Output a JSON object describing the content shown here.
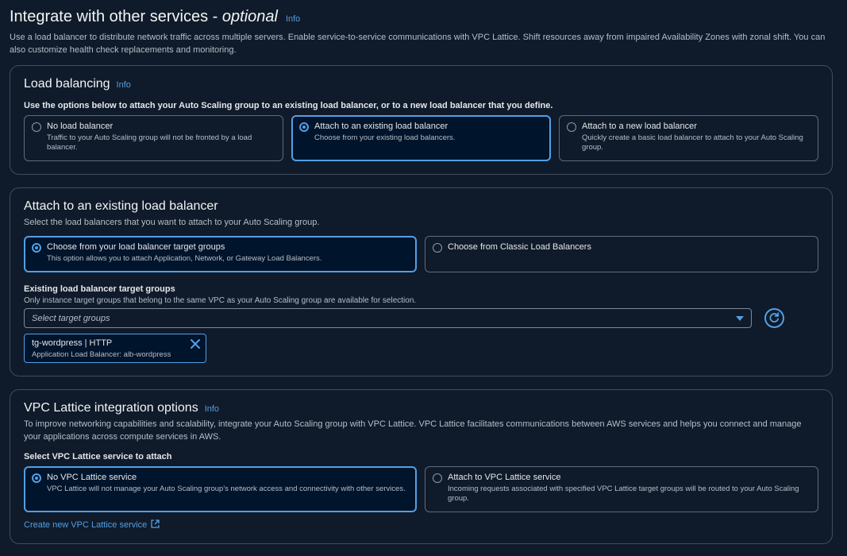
{
  "header": {
    "title": "Integrate with other services - ",
    "title_optional": "optional",
    "info": "Info",
    "description": "Use a load balancer to distribute network traffic across multiple servers. Enable service-to-service communications with VPC Lattice. Shift resources away from impaired Availability Zones with zonal shift. You can also customize health check replacements and monitoring."
  },
  "load_balancing": {
    "title": "Load balancing",
    "info": "Info",
    "instruction": "Use the options below to attach your Auto Scaling group to an existing load balancer, or to a new load balancer that you define.",
    "options": [
      {
        "title": "No load balancer",
        "desc": "Traffic to your Auto Scaling group will not be fronted by a load balancer.",
        "selected": false
      },
      {
        "title": "Attach to an existing load balancer",
        "desc": "Choose from your existing load balancers.",
        "selected": true
      },
      {
        "title": "Attach to a new load balancer",
        "desc": "Quickly create a basic load balancer to attach to your Auto Scaling group.",
        "selected": false
      }
    ]
  },
  "existing_lb": {
    "title": "Attach to an existing load balancer",
    "description": "Select the load balancers that you want to attach to your Auto Scaling group.",
    "options": [
      {
        "title": "Choose from your load balancer target groups",
        "desc": "This option allows you to attach Application, Network, or Gateway Load Balancers.",
        "selected": true
      },
      {
        "title": "Choose from Classic Load Balancers",
        "desc": "",
        "selected": false
      }
    ],
    "target_groups_label": "Existing load balancer target groups",
    "target_groups_desc": "Only instance target groups that belong to the same VPC as your Auto Scaling group are available for selection.",
    "select_placeholder": "Select target groups",
    "token": {
      "title": "tg-wordpress | HTTP",
      "desc": "Application Load Balancer: alb-wordpress"
    }
  },
  "vpc_lattice": {
    "title": "VPC Lattice integration options",
    "info": "Info",
    "description": "To improve networking capabilities and scalability, integrate your Auto Scaling group with VPC Lattice. VPC Lattice facilitates communications between AWS services and helps you connect and manage your applications across compute services in AWS.",
    "select_label": "Select VPC Lattice service to attach",
    "options": [
      {
        "title": "No VPC Lattice service",
        "desc": "VPC Lattice will not manage your Auto Scaling group's network access and connectivity with other services.",
        "selected": true
      },
      {
        "title": "Attach to VPC Lattice service",
        "desc": "Incoming requests associated with specified VPC Lattice target groups will be routed to your Auto Scaling group.",
        "selected": false
      }
    ],
    "create_link": "Create new VPC Lattice service"
  },
  "colors": {
    "accent": "#539fe5",
    "background": "#0f1b2a",
    "border": "#414d5c"
  },
  "icons": [
    "caret-down-icon",
    "refresh-icon",
    "close-icon",
    "external-link-icon"
  ]
}
